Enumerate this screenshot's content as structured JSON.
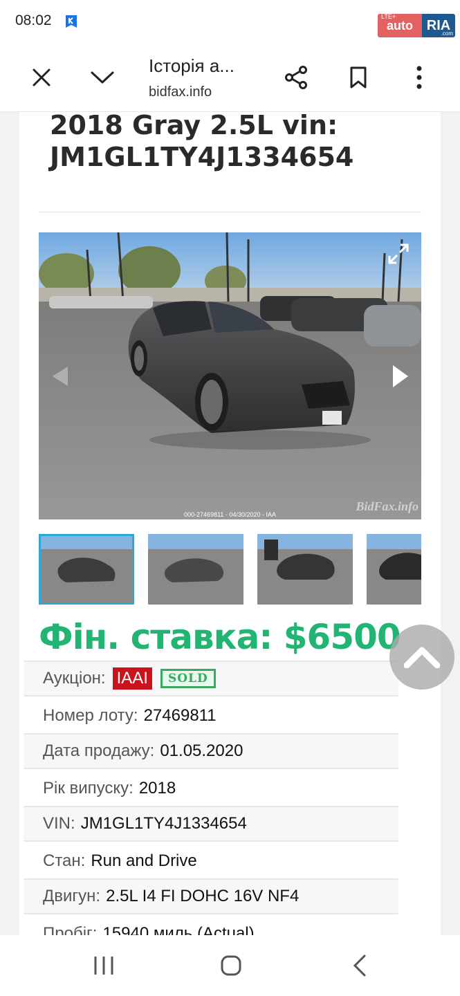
{
  "status_bar": {
    "time": "08:02",
    "lte": "LTE+",
    "badge_auto": "auto",
    "badge_ria": "RIA",
    "badge_ria_small": ".com"
  },
  "toolbar": {
    "title": "Історія а...",
    "url": "bidfax.info"
  },
  "car": {
    "title": "2018 Gray 2.5L vin: JM1GL1TY4J1334654",
    "photo_caption": "000-27469811 - 04/30/2020 - IAA",
    "watermark": "BidFax.info",
    "thumbnail_count": 4,
    "active_thumbnail": 0
  },
  "final_bid": "Фін. ставка: $6500",
  "details": {
    "auction_label": "Аукціон:",
    "auction_value": "IAAI",
    "sold_badge": "SOLD",
    "lot_label": "Номер лоту:",
    "lot_value": "27469811",
    "sale_date_label": "Дата продажу:",
    "sale_date_value": "01.05.2020",
    "year_label": "Рік випуску:",
    "year_value": "2018",
    "vin_label": "VIN:",
    "vin_value": "JM1GL1TY4J1334654",
    "condition_label": "Стан:",
    "condition_value": "Run and Drive",
    "engine_label": "Двигун:",
    "engine_value": "2.5L I4 FI DOHC 16V NF4",
    "mileage_label": "Пробіг:",
    "mileage_value": "15940 миль (Actual)"
  },
  "colors": {
    "accent_green": "#22b472",
    "iaai_red": "#c8141a",
    "active_thumb": "#2aa8d8"
  }
}
